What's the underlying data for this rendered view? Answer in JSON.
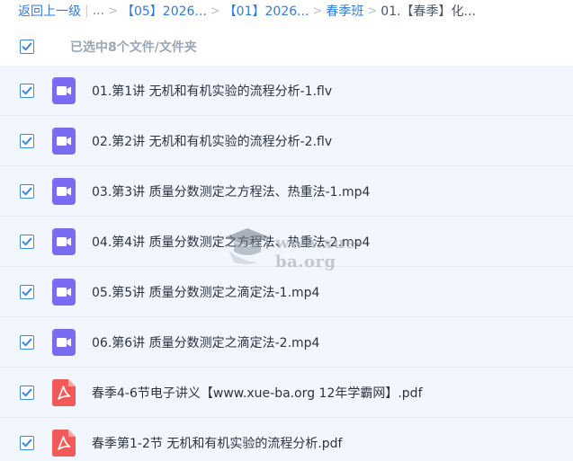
{
  "breadcrumb": {
    "back_label": "返回上一级",
    "ellipsis": "...",
    "crumbs": [
      "【05】2026...",
      "【01】2026...",
      "春季班"
    ],
    "current": "01.【春季】化..."
  },
  "selection": {
    "text": "已选中8个文件/文件夹"
  },
  "files": [
    {
      "name": "01.第1讲 无机和有机实验的流程分析-1.flv",
      "type": "video"
    },
    {
      "name": "02.第2讲 无机和有机实验的流程分析-2.flv",
      "type": "video"
    },
    {
      "name": "03.第3讲 质量分数测定之方程法、热重法-1.mp4",
      "type": "video"
    },
    {
      "name": "04.第4讲 质量分数测定之方程法、热重法-2.mp4",
      "type": "video"
    },
    {
      "name": "05.第5讲 质量分数测定之滴定法-1.mp4",
      "type": "video"
    },
    {
      "name": "06.第6讲 质量分数测定之滴定法-2.mp4",
      "type": "video"
    },
    {
      "name": "春季4-6节电子讲义【www.xue-ba.org 12年学霸网】.pdf",
      "type": "pdf"
    },
    {
      "name": "春季第1-2节 无机和有机实验的流程分析.pdf",
      "type": "pdf"
    }
  ],
  "watermark": {
    "text": "www.xue-ba.org"
  },
  "colors": {
    "accent": "#3b86e8",
    "video_icon": "#7a6cf0",
    "pdf_icon": "#f25a5a",
    "row_bg": "#f1f6ff"
  },
  "icons": {
    "video": "video-file-icon",
    "pdf": "pdf-file-icon",
    "check": "check-icon"
  }
}
